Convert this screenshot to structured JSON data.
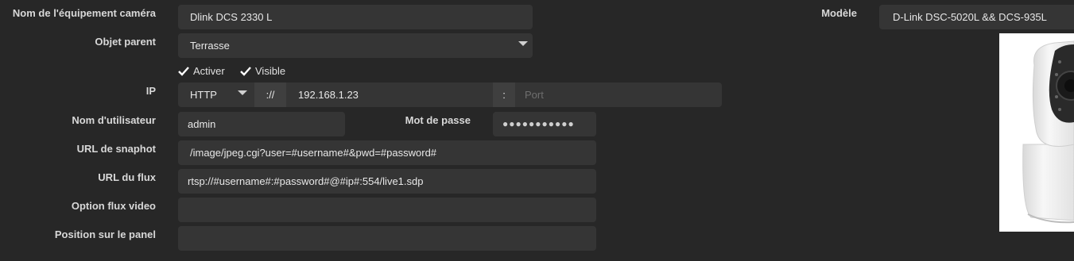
{
  "form": {
    "name_label": "Nom de l'équipement caméra",
    "name_value": "Dlink DCS 2330 L",
    "parent_label": "Objet parent",
    "parent_value": "Terrasse",
    "activer_label": "Activer",
    "visible_label": "Visible",
    "ip_label": "IP",
    "protocol_value": "HTTP",
    "protocol_sep": "://",
    "ip_value": "192.168.1.23",
    "port_sep": ":",
    "port_placeholder": "Port",
    "username_label": "Nom d'utilisateur",
    "username_value": "admin",
    "password_label": "Mot de passe",
    "password_value": "●●●●●●●●●●●",
    "snapshot_label": "URL de snaphot",
    "snapshot_value": "/image/jpeg.cgi?user=#username#&pwd=#password#",
    "stream_label": "URL du flux",
    "stream_value": "rtsp://#username#:#password#@#ip#:554/live1.sdp",
    "video_option_label": "Option flux video",
    "video_option_value": "",
    "panel_position_label": "Position sur le panel",
    "panel_position_value": ""
  },
  "model": {
    "label": "Modèle",
    "value": "D-Link DSC-5020L && DCS-935L"
  }
}
